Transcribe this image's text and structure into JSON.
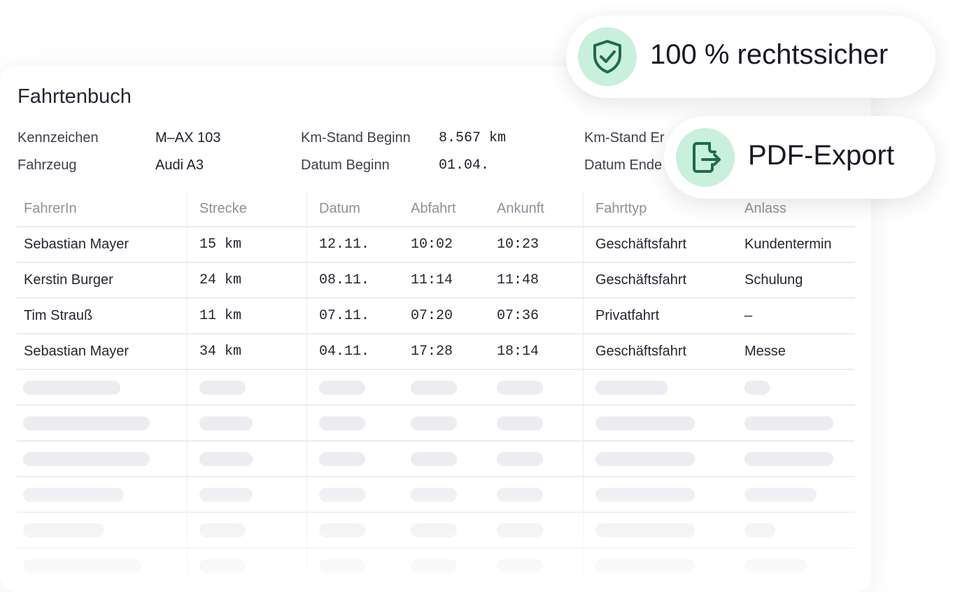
{
  "title": "Fahrtenbuch",
  "meta": {
    "kennzeichen_label": "Kennzeichen",
    "kennzeichen_value": "M–AX 103",
    "fahrzeug_label": "Fahrzeug",
    "fahrzeug_value": "Audi A3",
    "km_beginn_label": "Km-Stand Beginn",
    "km_beginn_value": "8.567 km",
    "datum_beginn_label": "Datum Beginn",
    "datum_beginn_value": "01.04.",
    "km_ende_label": "Km-Stand Er",
    "datum_ende_label": "Datum Ende"
  },
  "table": {
    "headers": [
      "FahrerIn",
      "Strecke",
      "Datum",
      "Abfahrt",
      "Ankunft",
      "Fahrttyp",
      "Anlass"
    ],
    "rows": [
      [
        "Sebastian Mayer",
        "15 km",
        "12.11.",
        "10:02",
        "10:23",
        "Geschäftsfahrt",
        "Kundentermin"
      ],
      [
        "Kerstin Burger",
        "24 km",
        "08.11.",
        "11:14",
        "11:48",
        "Geschäftsfahrt",
        "Schulung"
      ],
      [
        "Tim Strauß",
        "11 km",
        "07.11.",
        "07:20",
        "07:36",
        "Privatfahrt",
        "–"
      ],
      [
        "Sebastian Mayer",
        "34 km",
        "04.11.",
        "17:28",
        "18:14",
        "Geschäftsfahrt",
        "Messe"
      ]
    ]
  },
  "badges": {
    "rechtssicher": "100 % rechtssicher",
    "pdf_export": "PDF-Export"
  },
  "icons": {
    "rechtssicher": "shield-check-icon",
    "pdf_export": "file-export-icon"
  },
  "colors": {
    "accent_bg": "#c8f0dc",
    "accent_icon": "#1f6b4a"
  }
}
